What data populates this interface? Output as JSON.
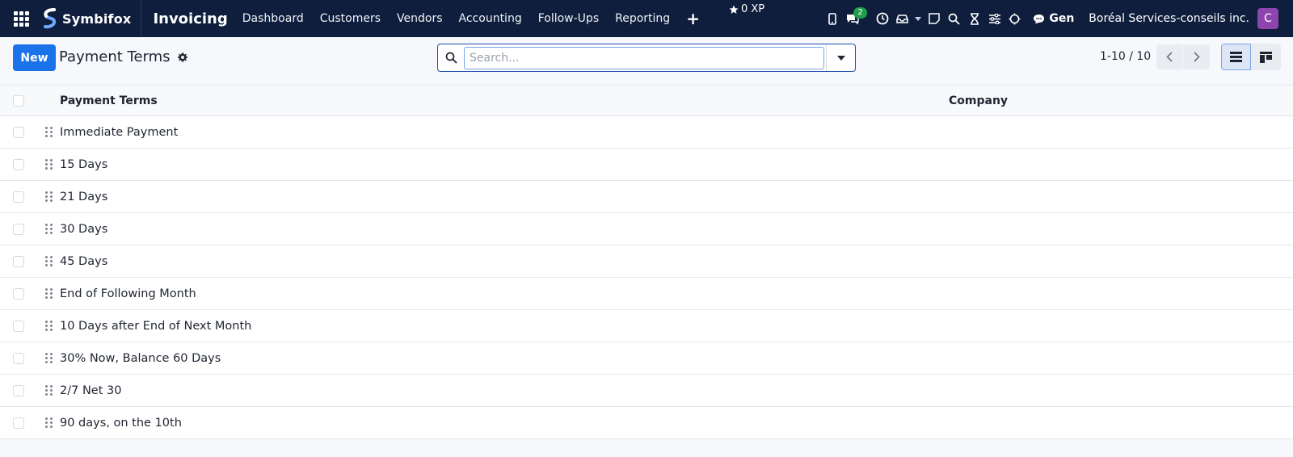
{
  "navbar": {
    "brand": "Symbifox",
    "app_title": "Invoicing",
    "menu": [
      "Dashboard",
      "Customers",
      "Vendors",
      "Accounting",
      "Follow-Ups",
      "Reporting"
    ],
    "xp": "0 XP",
    "messages_badge": "2",
    "ai_label": "Gen",
    "company": "Boréal Services-conseils inc.",
    "avatar_initial": "C",
    "avatar_color": "#8e44ad"
  },
  "control_panel": {
    "new_label": "New",
    "breadcrumb": "Payment Terms",
    "search_placeholder": "Search...",
    "pager": "1-10 / 10"
  },
  "list": {
    "columns": [
      "Payment Terms",
      "Company"
    ],
    "rows": [
      {
        "name": "Immediate Payment",
        "company": ""
      },
      {
        "name": "15 Days",
        "company": ""
      },
      {
        "name": "21 Days",
        "company": ""
      },
      {
        "name": "30 Days",
        "company": ""
      },
      {
        "name": "45 Days",
        "company": ""
      },
      {
        "name": "End of Following Month",
        "company": ""
      },
      {
        "name": "10 Days after End of Next Month",
        "company": ""
      },
      {
        "name": "30% Now, Balance 60 Days",
        "company": ""
      },
      {
        "name": "2/7 Net 30",
        "company": ""
      },
      {
        "name": "90 days, on the 10th",
        "company": ""
      }
    ]
  },
  "colors": {
    "navbar_bg": "#0f1e3d",
    "primary": "#1a73e8",
    "badge_green": "#1e9e4a"
  }
}
